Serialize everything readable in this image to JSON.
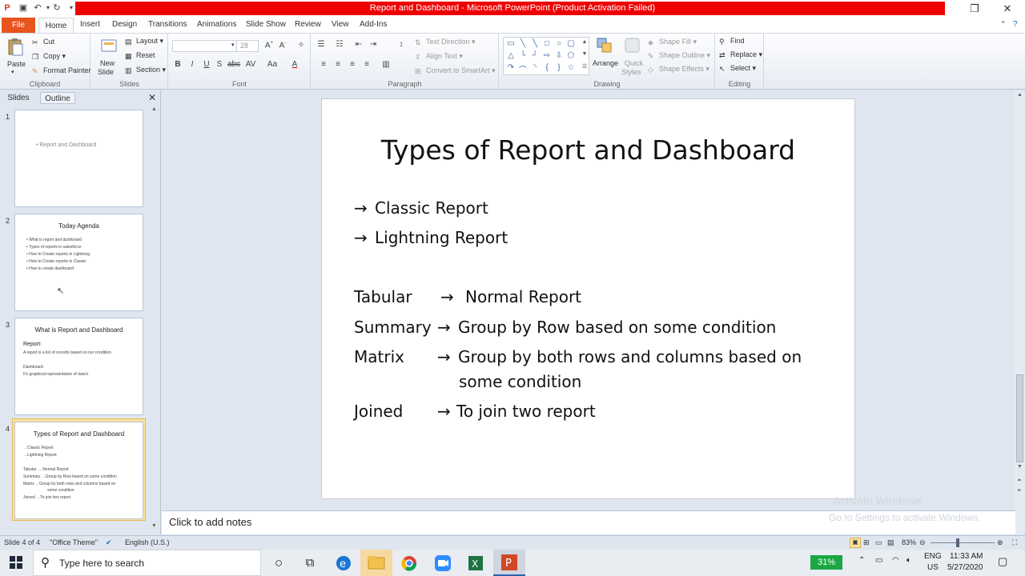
{
  "window": {
    "title": "Report and Dashboard - Microsoft PowerPoint (Product Activation Failed)",
    "title_bar_color": "#ee0000"
  },
  "ribbon_tabs": [
    "File",
    "Home",
    "Insert",
    "Design",
    "Transitions",
    "Animations",
    "Slide Show",
    "Review",
    "View",
    "Add-Ins"
  ],
  "ribbon": {
    "clipboard": {
      "label": "Clipboard",
      "paste": "Paste",
      "cut": "Cut",
      "copy": "Copy",
      "format_painter": "Format Painter"
    },
    "slides": {
      "label": "Slides",
      "new_slide_1": "New",
      "new_slide_2": "Slide",
      "layout": "Layout",
      "reset": "Reset",
      "section": "Section"
    },
    "font": {
      "label": "Font",
      "size": "28"
    },
    "paragraph": {
      "label": "Paragraph",
      "text_direction": "Text Direction",
      "align_text": "Align Text",
      "convert_smartart": "Convert to SmartArt"
    },
    "drawing": {
      "label": "Drawing",
      "arrange": "Arrange",
      "quick_styles_1": "Quick",
      "quick_styles_2": "Styles",
      "shape_fill": "Shape Fill",
      "shape_outline": "Shape Outline",
      "shape_effects": "Shape Effects"
    },
    "editing": {
      "label": "Editing",
      "find": "Find",
      "replace": "Replace",
      "select": "Select"
    }
  },
  "panel": {
    "tabs": [
      "Slides",
      "Outline"
    ],
    "close": "✕",
    "thumbnails": [
      {
        "num": "1",
        "lines": [
          "•  Report and Dashboard"
        ]
      },
      {
        "num": "2",
        "title": "Today Agenda",
        "lines": [
          "•  What is report and dashboard",
          "•  Types of reports in salesforce",
          "•  How to Create reports in Lightning",
          "•  How to Create reports in Classic",
          "•  How to create dashboard"
        ]
      },
      {
        "num": "3",
        "title": "What is Report and Dashboard",
        "lines": [
          "Report:",
          "A report is a list of records based on our condition",
          "Dashboard:",
          "It's graphical representation of data's"
        ]
      },
      {
        "num": "4",
        "title": "Types of Report and Dashboard",
        "lines": [
          "→Classic Report",
          "→Lightning Report",
          "Tabular      → Normal Report",
          "Summary  →Group by Row based on some condition",
          "Matrix      →Group by both rows and columns based on",
          "some condition",
          "Joined      →To join two report"
        ]
      }
    ]
  },
  "slide": {
    "title": "Types of Report and Dashboard",
    "arrow": "→",
    "items": [
      "Classic Report",
      "Lightning Report"
    ],
    "rows": [
      {
        "label": "Tabular",
        "text": "Normal Report"
      },
      {
        "label": "Summary",
        "text": "Group by Row based on some condition"
      },
      {
        "label": "Matrix",
        "text": "Group by both rows and columns based on",
        "text2": "some condition"
      },
      {
        "label": "Joined",
        "text": "To join two report"
      }
    ]
  },
  "notes": {
    "placeholder": "Click to add notes"
  },
  "watermark": {
    "line1": "Activate Windows",
    "line2": "Go to Settings to activate Windows."
  },
  "status": {
    "slide": "Slide 4 of 4",
    "theme": "\"Office Theme\"",
    "language": "English (U.S.)",
    "zoom": "83%"
  },
  "taskbar": {
    "search_placeholder": "Type here to search",
    "battery": "31%",
    "lang1": "ENG",
    "lang2": "US",
    "time": "11:33 AM",
    "date": "5/27/2020"
  }
}
